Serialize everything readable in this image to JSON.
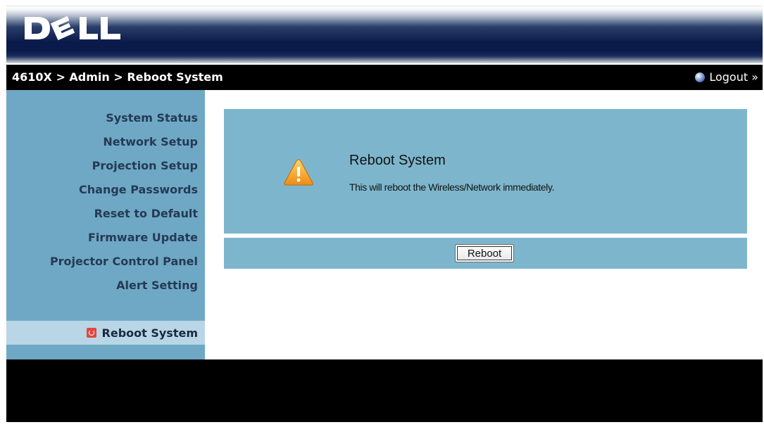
{
  "brand": {
    "logo_text": "DELL"
  },
  "breadcrumb": {
    "text": "4610X > Admin > Reboot System"
  },
  "logout": {
    "label": "Logout »"
  },
  "sidebar": {
    "items": [
      {
        "label": "System Status"
      },
      {
        "label": "Network Setup"
      },
      {
        "label": "Projection Setup"
      },
      {
        "label": "Change Passwords"
      },
      {
        "label": "Reset to Default"
      },
      {
        "label": "Firmware Update"
      },
      {
        "label": "Projector Control Panel"
      },
      {
        "label": "Alert Setting"
      }
    ],
    "active": {
      "label": "Reboot System",
      "icon": "power-icon"
    }
  },
  "content": {
    "title": "Reboot System",
    "description": "This will reboot the Wireless/Network immediately.",
    "warning_icon": "warning-icon",
    "reboot_button": "Reboot"
  },
  "colors": {
    "sidebar": "#6fa8c4",
    "sidebar_active": "#b8d6e6",
    "panel": "#7db6cc",
    "bar": "#000000"
  }
}
